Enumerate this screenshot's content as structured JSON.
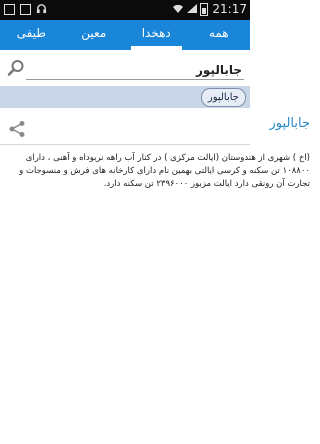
{
  "status_bar": {
    "time": "21:17",
    "icons": [
      "sd-card-icon",
      "image-icon",
      "headphones-icon",
      "wifi-icon",
      "signal-icon",
      "battery-icon"
    ]
  },
  "tabs": [
    {
      "label": "همه",
      "active": false
    },
    {
      "label": "دهخدا",
      "active": true
    },
    {
      "label": "معین",
      "active": false
    },
    {
      "label": "طیفی",
      "active": false
    }
  ],
  "search": {
    "value": "جابالپور",
    "placeholder": ""
  },
  "chip": {
    "label": "جابالپور"
  },
  "result": {
    "title": "جابالپور",
    "body": "(اخ ) شهری از هندوستان (ایالت مرکزی ) در کنار آب راهه نربوداه و آهنی ، دارای ۱۰۸۸۰۰ تن سکنه و کرسی ایالتی بهمین نام دارای کارخانه های فرش و منسوجات و تجارت آن رونقی دارد ایالت مزبور ۲۳۹۶۰۰۰ تن سکنه دارد."
  },
  "colors": {
    "accent": "#1a86d9",
    "title": "#2a8ac7",
    "chip_strip": "#c9d6e8"
  }
}
